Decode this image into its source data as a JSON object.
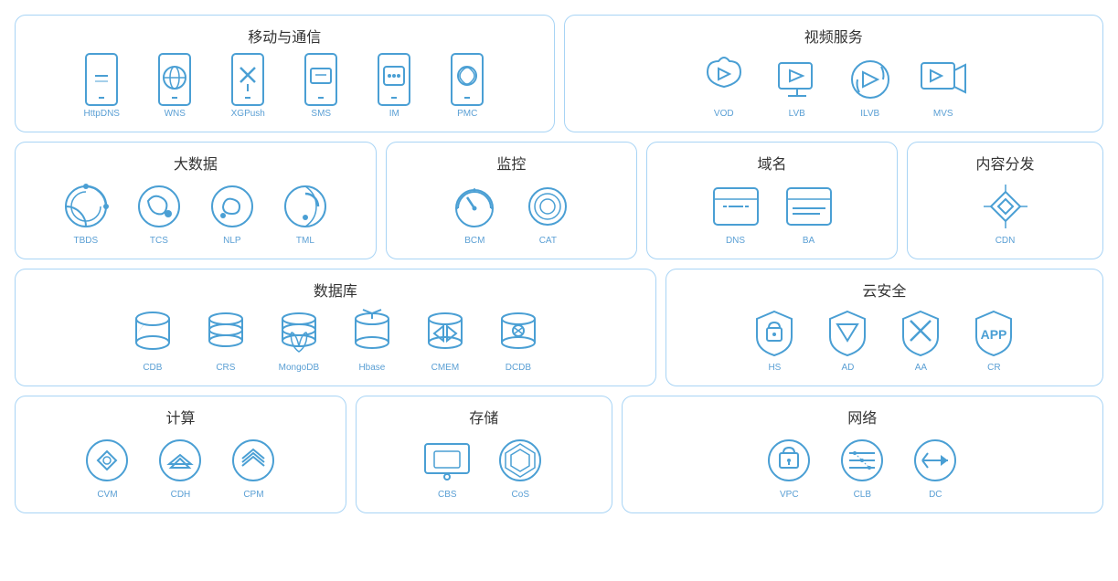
{
  "sections": {
    "mobile": {
      "title": "移动与通信",
      "items": [
        {
          "id": "httpdns",
          "label": "HttpDNS"
        },
        {
          "id": "wns",
          "label": "WNS"
        },
        {
          "id": "xgpush",
          "label": "XGPush"
        },
        {
          "id": "sms",
          "label": "SMS"
        },
        {
          "id": "im",
          "label": "IM"
        },
        {
          "id": "pmc",
          "label": "PMC"
        }
      ]
    },
    "video": {
      "title": "视频服务",
      "items": [
        {
          "id": "vod",
          "label": "VOD"
        },
        {
          "id": "lvb",
          "label": "LVB"
        },
        {
          "id": "ilvb",
          "label": "ILVB"
        },
        {
          "id": "mvs",
          "label": "MVS"
        }
      ]
    },
    "bigdata": {
      "title": "大数据",
      "items": [
        {
          "id": "tbds",
          "label": "TBDS"
        },
        {
          "id": "tcs",
          "label": "TCS"
        },
        {
          "id": "nlp",
          "label": "NLP"
        },
        {
          "id": "tml",
          "label": "TML"
        }
      ]
    },
    "monitor": {
      "title": "监控",
      "items": [
        {
          "id": "bcm",
          "label": "BCM"
        },
        {
          "id": "cat",
          "label": "CAT"
        }
      ]
    },
    "domain": {
      "title": "域名",
      "items": [
        {
          "id": "dns",
          "label": "DNS"
        },
        {
          "id": "ba",
          "label": "BA"
        }
      ]
    },
    "cdn": {
      "title": "内容分发",
      "items": [
        {
          "id": "cdn",
          "label": "CDN"
        }
      ]
    },
    "database": {
      "title": "数据库",
      "items": [
        {
          "id": "cdb",
          "label": "CDB"
        },
        {
          "id": "crs",
          "label": "CRS"
        },
        {
          "id": "mongodb",
          "label": "MongoDB"
        },
        {
          "id": "hbase",
          "label": "Hbase"
        },
        {
          "id": "cmem",
          "label": "CMEM"
        },
        {
          "id": "dcdb",
          "label": "DCDB"
        }
      ]
    },
    "security": {
      "title": "云安全",
      "items": [
        {
          "id": "hs",
          "label": "HS"
        },
        {
          "id": "ad",
          "label": "AD"
        },
        {
          "id": "aa",
          "label": "AA"
        },
        {
          "id": "cr",
          "label": "CR"
        }
      ]
    },
    "compute": {
      "title": "计算",
      "items": [
        {
          "id": "cvm",
          "label": "CVM"
        },
        {
          "id": "cdh",
          "label": "CDH"
        },
        {
          "id": "cpm",
          "label": "CPM"
        }
      ]
    },
    "storage": {
      "title": "存储",
      "items": [
        {
          "id": "cbs",
          "label": "CBS"
        },
        {
          "id": "cos",
          "label": "CoS"
        }
      ]
    },
    "network": {
      "title": "网络",
      "items": [
        {
          "id": "vpc",
          "label": "VPC"
        },
        {
          "id": "clb",
          "label": "CLB"
        },
        {
          "id": "dc",
          "label": "DC"
        }
      ]
    }
  },
  "colors": {
    "primary": "#4a9fd4",
    "border": "#a8d4f5",
    "label": "#5a9fd4",
    "title": "#333333"
  }
}
